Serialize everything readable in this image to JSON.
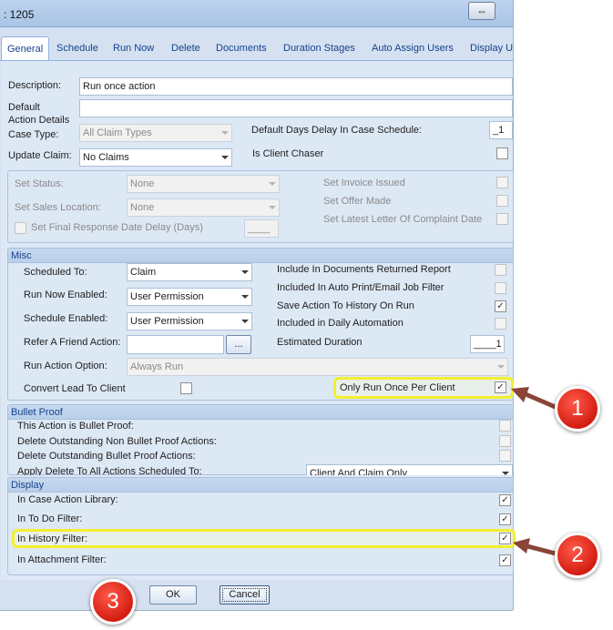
{
  "window": {
    "title": ": 1205",
    "restore_glyph": "⇔"
  },
  "tabs": [
    {
      "label": "General",
      "active": true
    },
    {
      "label": "Schedule"
    },
    {
      "label": "Run Now"
    },
    {
      "label": "Delete"
    },
    {
      "label": "Documents"
    },
    {
      "label": "Duration Stages"
    },
    {
      "label": "Auto Assign Users"
    },
    {
      "label": "Display U"
    }
  ],
  "general": {
    "description_label": "Description:",
    "description_value": "Run once action",
    "default_action_details_label_line1": "Default",
    "default_action_details_label_line2": "Action Details",
    "case_type_label": "Case Type:",
    "case_type_value": "All Claim Types",
    "default_days_delay_label": "Default Days Delay In Case Schedule:",
    "default_days_delay_value": "_1",
    "update_claim_label": "Update Claim:",
    "update_claim_value": "No Claims",
    "is_client_chaser_label": "Is Client Chaser"
  },
  "status_group": {
    "set_status_label": "Set Status:",
    "set_status_value": "None",
    "set_sales_location_label": "Set Sales Location:",
    "set_sales_location_value": "None",
    "set_final_response_label": "Set Final Response Date Delay (Days)",
    "set_final_response_value": "____",
    "set_invoice_issued_label": "Set Invoice Issued",
    "set_offer_made_label": "Set Offer Made",
    "set_latest_letter_label": "Set Latest Letter Of Complaint Date"
  },
  "misc": {
    "header": "Misc",
    "scheduled_to_label": "Scheduled To:",
    "scheduled_to_value": "Claim",
    "run_now_enabled_label": "Run Now Enabled:",
    "run_now_enabled_value": "User Permission",
    "schedule_enabled_label": "Schedule Enabled:",
    "schedule_enabled_value": "User Permission",
    "refer_a_friend_label": "Refer A Friend Action:",
    "refer_a_friend_button": "...",
    "run_action_option_label": "Run Action Option:",
    "run_action_option_value": "Always Run",
    "convert_lead_label": "Convert Lead To Client",
    "include_docs_returned_label": "Include In Documents Returned Report",
    "included_auto_print_label": "Included In Auto Print/Email Job Filter",
    "save_action_history_label": "Save Action To History On Run",
    "included_daily_automation_label": "Included in Daily Automation",
    "estimated_duration_label": "Estimated Duration",
    "estimated_duration_value": "____1",
    "only_run_once_label": "Only Run Once Per Client",
    "check_glyph": "✓"
  },
  "bullet_proof": {
    "header": "Bullet Proof",
    "is_bullet_proof_label": "This Action is Bullet Proof:",
    "delete_non_bullet_label": "Delete Outstanding Non Bullet Proof Actions:",
    "delete_bullet_label": "Delete Outstanding Bullet Proof Actions:",
    "apply_delete_label": "Apply Delete To All Actions Scheduled To:",
    "apply_delete_value": "Client And Claim Only"
  },
  "display": {
    "header": "Display",
    "in_case_action_library_label": "In Case Action Library:",
    "in_to_do_filter_label": "In To Do Filter:",
    "in_history_filter_label": "In History Filter:",
    "in_attachment_filter_label": "In Attachment Filter:"
  },
  "footer": {
    "ok_label": "OK",
    "cancel_label": "Cancel"
  },
  "callouts": {
    "one": "1",
    "two": "2",
    "three": "3"
  },
  "colors": {
    "highlight": "#f3ef2e",
    "callout_red": "#d41d12",
    "tab_text": "#15428b"
  }
}
